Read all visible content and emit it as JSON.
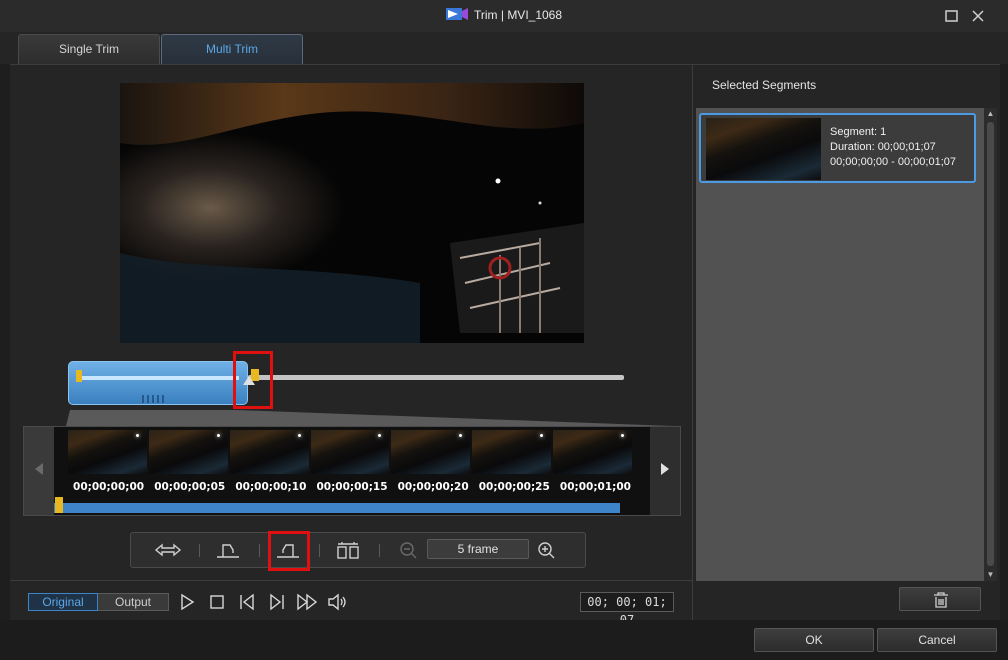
{
  "window": {
    "title": "Trim | MVI_1068"
  },
  "tabs": [
    {
      "label": "Single Trim",
      "active": false
    },
    {
      "label": "Multi Trim",
      "active": true
    }
  ],
  "filmstrip": {
    "timecodes": [
      "00;00;00;00",
      "00;00;00;05",
      "00;00;00;10",
      "00;00;00;15",
      "00;00;00;20",
      "00;00;00;25",
      "00;00;01;00"
    ]
  },
  "toolbar": {
    "zoom_value": "5 frame"
  },
  "playback": {
    "original_label": "Original",
    "output_label": "Output",
    "current_time": "00; 00; 01; 07"
  },
  "segments_panel": {
    "title": "Selected Segments",
    "items": [
      {
        "segment": "Segment: 1",
        "duration": "Duration: 00;00;01;07",
        "range": "00;00;00;00 - 00;00;01;07"
      }
    ]
  },
  "footer": {
    "ok_label": "OK",
    "cancel_label": "Cancel"
  },
  "colors": {
    "accent": "#3d84c8",
    "highlight": "#e01010",
    "marker": "#e8b820"
  }
}
